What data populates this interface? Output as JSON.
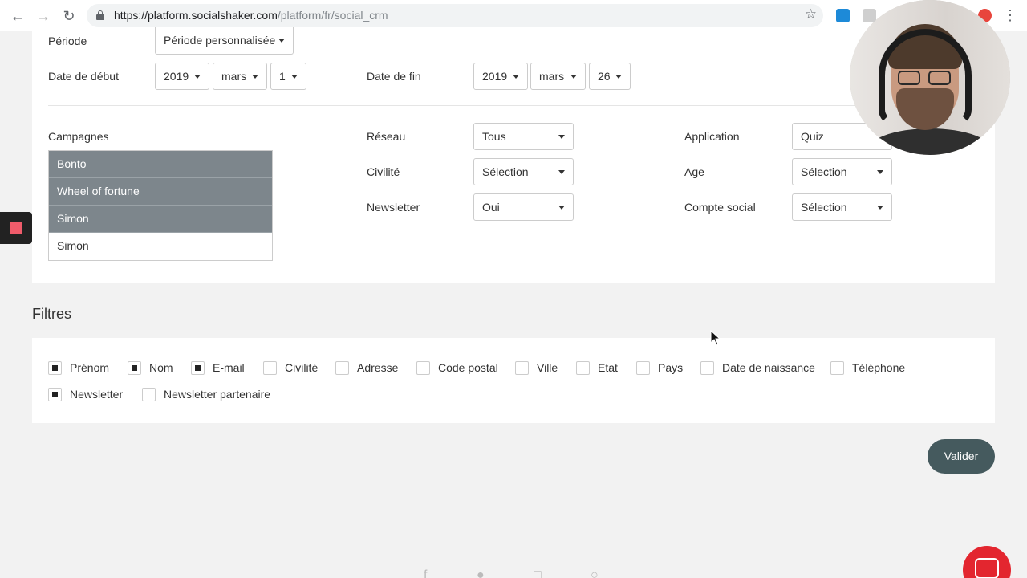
{
  "browser": {
    "url_host": "https://platform.socialshaker.com",
    "url_path": "/platform/fr/social_crm"
  },
  "period": {
    "label": "Période",
    "value": "Période personnalisée"
  },
  "start_date": {
    "label": "Date de début",
    "year": "2019",
    "month": "mars",
    "day": "1"
  },
  "end_date": {
    "label": "Date de fin",
    "year": "2019",
    "month": "mars",
    "day": "26"
  },
  "campaigns": {
    "label": "Campagnes",
    "items": [
      {
        "label": "Bonto",
        "selected": true
      },
      {
        "label": "Wheel of fortune",
        "selected": true
      },
      {
        "label": "Simon",
        "selected": true
      },
      {
        "label": "Simon",
        "selected": false
      }
    ]
  },
  "filters_top": {
    "reseau": {
      "label": "Réseau",
      "value": "Tous"
    },
    "civilite": {
      "label": "Civilité",
      "value": "Sélection"
    },
    "newsletter": {
      "label": "Newsletter",
      "value": "Oui"
    },
    "application": {
      "label": "Application",
      "value": "Quiz"
    },
    "age": {
      "label": "Age",
      "value": "Sélection"
    },
    "compte_social": {
      "label": "Compte social",
      "value": "Sélection"
    }
  },
  "filtres": {
    "title": "Filtres",
    "checkboxes": [
      {
        "label": "Prénom",
        "checked": true
      },
      {
        "label": "Nom",
        "checked": true
      },
      {
        "label": "E-mail",
        "checked": true
      },
      {
        "label": "Civilité",
        "checked": false
      },
      {
        "label": "Adresse",
        "checked": false
      },
      {
        "label": "Code postal",
        "checked": false
      },
      {
        "label": "Ville",
        "checked": false
      },
      {
        "label": "Etat",
        "checked": false
      },
      {
        "label": "Pays",
        "checked": false
      },
      {
        "label": "Date de naissance",
        "checked": false
      },
      {
        "label": "Téléphone",
        "checked": false
      },
      {
        "label": "Newsletter",
        "checked": true
      },
      {
        "label": "Newsletter partenaire",
        "checked": false
      }
    ]
  },
  "actions": {
    "submit_label": "Valider"
  },
  "icons": {
    "back": "arrow-left-icon",
    "forward": "arrow-right-icon",
    "reload": "reload-icon",
    "lock": "lock-icon",
    "bookmark": "star-icon",
    "menu": "kebab-menu-icon",
    "record": "record-icon",
    "chat": "chat-icon"
  },
  "colors": {
    "selected_item_bg": "#7d868c",
    "submit_bg": "#455a5e",
    "chat_bg": "#e3262f",
    "record_dot": "#f05c6b"
  }
}
